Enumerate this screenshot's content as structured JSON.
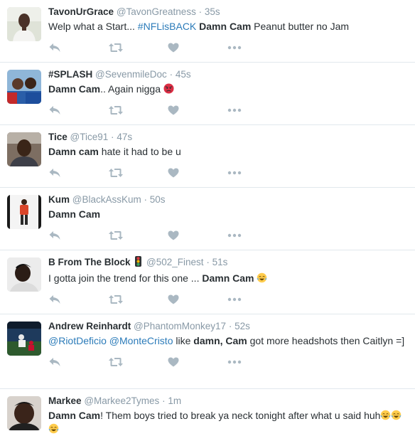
{
  "tweets": [
    {
      "name": "TavonUrGrace",
      "handle": "@TavonGreatness",
      "time": "35s",
      "segments": [
        {
          "t": "Welp what a Start... ",
          "s": "n"
        },
        {
          "t": "#NFLisBACK",
          "s": "l"
        },
        {
          "t": " ",
          "s": "n"
        },
        {
          "t": "Damn Cam",
          "s": "b"
        },
        {
          "t": " Peanut butter no Jam",
          "s": "n"
        }
      ],
      "emojis": []
    },
    {
      "name": "#SPLASH",
      "handle": "@SevenmileDoc",
      "time": "45s",
      "segments": [
        {
          "t": "Damn Cam",
          "s": "b"
        },
        {
          "t": ".. Again nigga ",
          "s": "n"
        }
      ],
      "emojis": [
        "angry-face"
      ]
    },
    {
      "name": "Tice",
      "handle": "@Tice91",
      "time": "47s",
      "segments": [
        {
          "t": "Damn cam",
          "s": "b"
        },
        {
          "t": " hate it had to be u",
          "s": "n"
        }
      ],
      "emojis": []
    },
    {
      "name": "Kum",
      "handle": "@BlackAssKum",
      "time": "50s",
      "segments": [
        {
          "t": "Damn Cam",
          "s": "b"
        }
      ],
      "emojis": []
    },
    {
      "name": "B From The Block",
      "handle": "@502_Finest",
      "time": "51s",
      "badge": "traffic-light-emoji",
      "segments": [
        {
          "t": "I gotta join the trend for this one ... ",
          "s": "n"
        },
        {
          "t": "Damn Cam",
          "s": "b"
        },
        {
          "t": " ",
          "s": "n"
        }
      ],
      "emojis": [
        "tears-of-joy"
      ]
    },
    {
      "name": "Andrew Reinhardt",
      "handle": "@PhantomMonkey17",
      "time": "52s",
      "segments": [
        {
          "t": "@RiotDeficio",
          "s": "l"
        },
        {
          "t": " ",
          "s": "n"
        },
        {
          "t": "@MonteCristo",
          "s": "l"
        },
        {
          "t": " like ",
          "s": "n"
        },
        {
          "t": "damn, Cam",
          "s": "b"
        },
        {
          "t": " got more headshots then Caitlyn =]",
          "s": "n"
        }
      ],
      "emojis": []
    },
    {
      "name": "Markee",
      "handle": "@Markee2Tymes",
      "time": "1m",
      "segments": [
        {
          "t": "Damn Cam",
          "s": "b"
        },
        {
          "t": "! Them boys tried to break ya neck tonight after what u said huh",
          "s": "n"
        }
      ],
      "emojis": [
        "tears-of-joy",
        "tears-of-joy",
        "tears-of-joy"
      ]
    }
  ],
  "actions": [
    "reply-icon",
    "retweet-icon",
    "like-icon",
    "more-icon"
  ],
  "colors": {
    "link": "#2b7bb9",
    "muted": "#8899a6",
    "icon": "#aab8c2",
    "text": "#292f33",
    "divider": "#e1e8ed"
  }
}
